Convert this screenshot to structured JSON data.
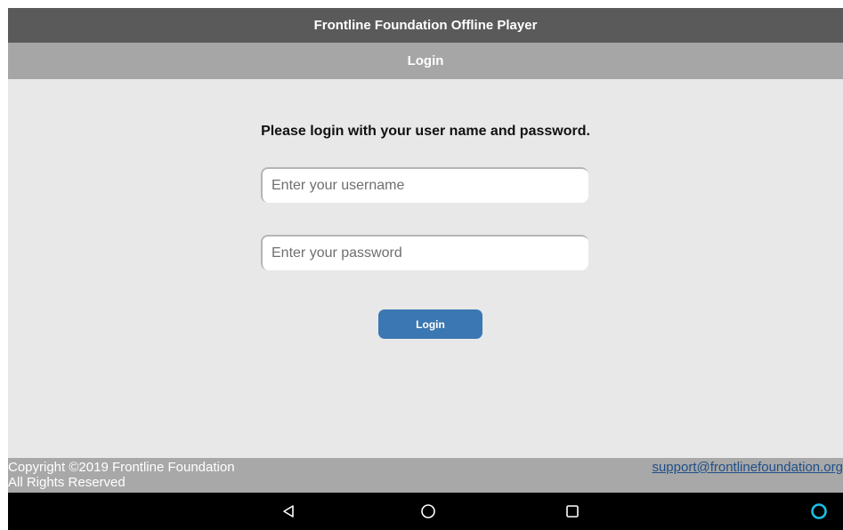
{
  "app": {
    "title": "Frontline Foundation Offline Player",
    "subtitle": "Login"
  },
  "login": {
    "prompt": "Please login with your user name and password.",
    "username_placeholder": "Enter your username",
    "username_value": "",
    "password_placeholder": "Enter your password",
    "password_value": "",
    "button_label": "Login"
  },
  "footer": {
    "copyright_line1": "Copyright ©2019 Frontline Foundation",
    "copyright_line2": "All Rights Reserved",
    "support_email": "support@frontlinefoundation.org"
  },
  "navbar": {
    "icons": [
      "back-icon",
      "home-icon",
      "recent-apps-icon",
      "assistant-icon"
    ]
  },
  "colors": {
    "titlebar": "#5a5a5a",
    "subbar": "#a6a6a6",
    "background": "#e8e8e8",
    "button": "#3b77b2",
    "link": "#1f4f88",
    "assistant": "#19c0e6"
  }
}
